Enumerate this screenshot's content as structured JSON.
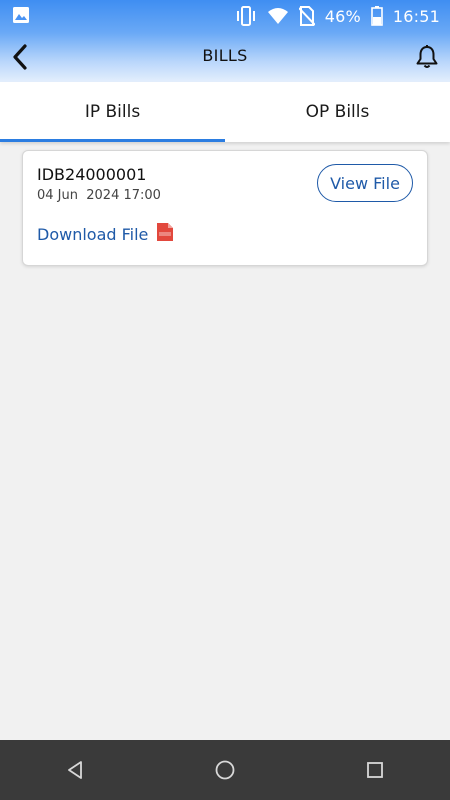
{
  "status_bar": {
    "battery_percent": "46%",
    "time": "16:51",
    "icons": [
      "gallery-icon",
      "vibrate-icon",
      "wifi-icon",
      "no-sim-icon",
      "battery-icon"
    ]
  },
  "header": {
    "title": "BILLS",
    "back_icon": "chevron-left-icon",
    "bell_icon": "bell-icon"
  },
  "tabs": [
    {
      "label": "IP Bills",
      "active": true
    },
    {
      "label": "OP Bills",
      "active": false
    }
  ],
  "bills": [
    {
      "id": "IDB24000001",
      "date": "04 Jun  2024 17:00",
      "view_label": "View File",
      "download_label": "Download File",
      "file_icon": "pdf-icon"
    }
  ],
  "nav": {
    "back_icon": "nav-back-icon",
    "home_icon": "nav-home-icon",
    "recents_icon": "nav-recents-icon"
  },
  "colors": {
    "header_gradient_top": "#3f8ef2",
    "accent": "#2b7de1",
    "link": "#1f5aa8",
    "nav_bar": "#3a3a3a",
    "pdf_red": "#e2483d"
  }
}
